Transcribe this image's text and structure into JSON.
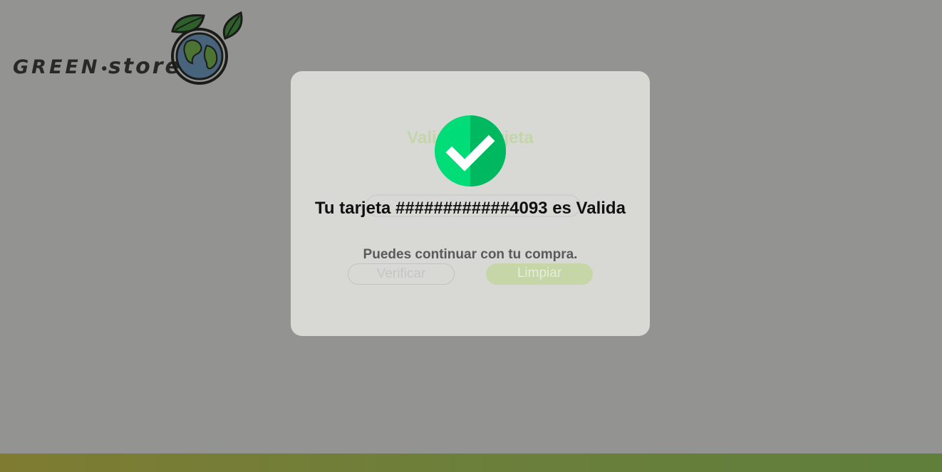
{
  "brand": {
    "word1": "GREEN",
    "separator": "•",
    "word2": "store"
  },
  "form": {
    "title": "Valida tu tarjeta",
    "verify_label": "Verificar",
    "clear_label": "Limpiar"
  },
  "alert": {
    "icon": "success-check-icon",
    "title": "Tu tarjeta ############4093 es Valida",
    "text": "Puedes continuar con tu compra."
  },
  "colors": {
    "success": "#00d275",
    "accent": "#9bd65a",
    "overlay": "#8f8f88"
  }
}
